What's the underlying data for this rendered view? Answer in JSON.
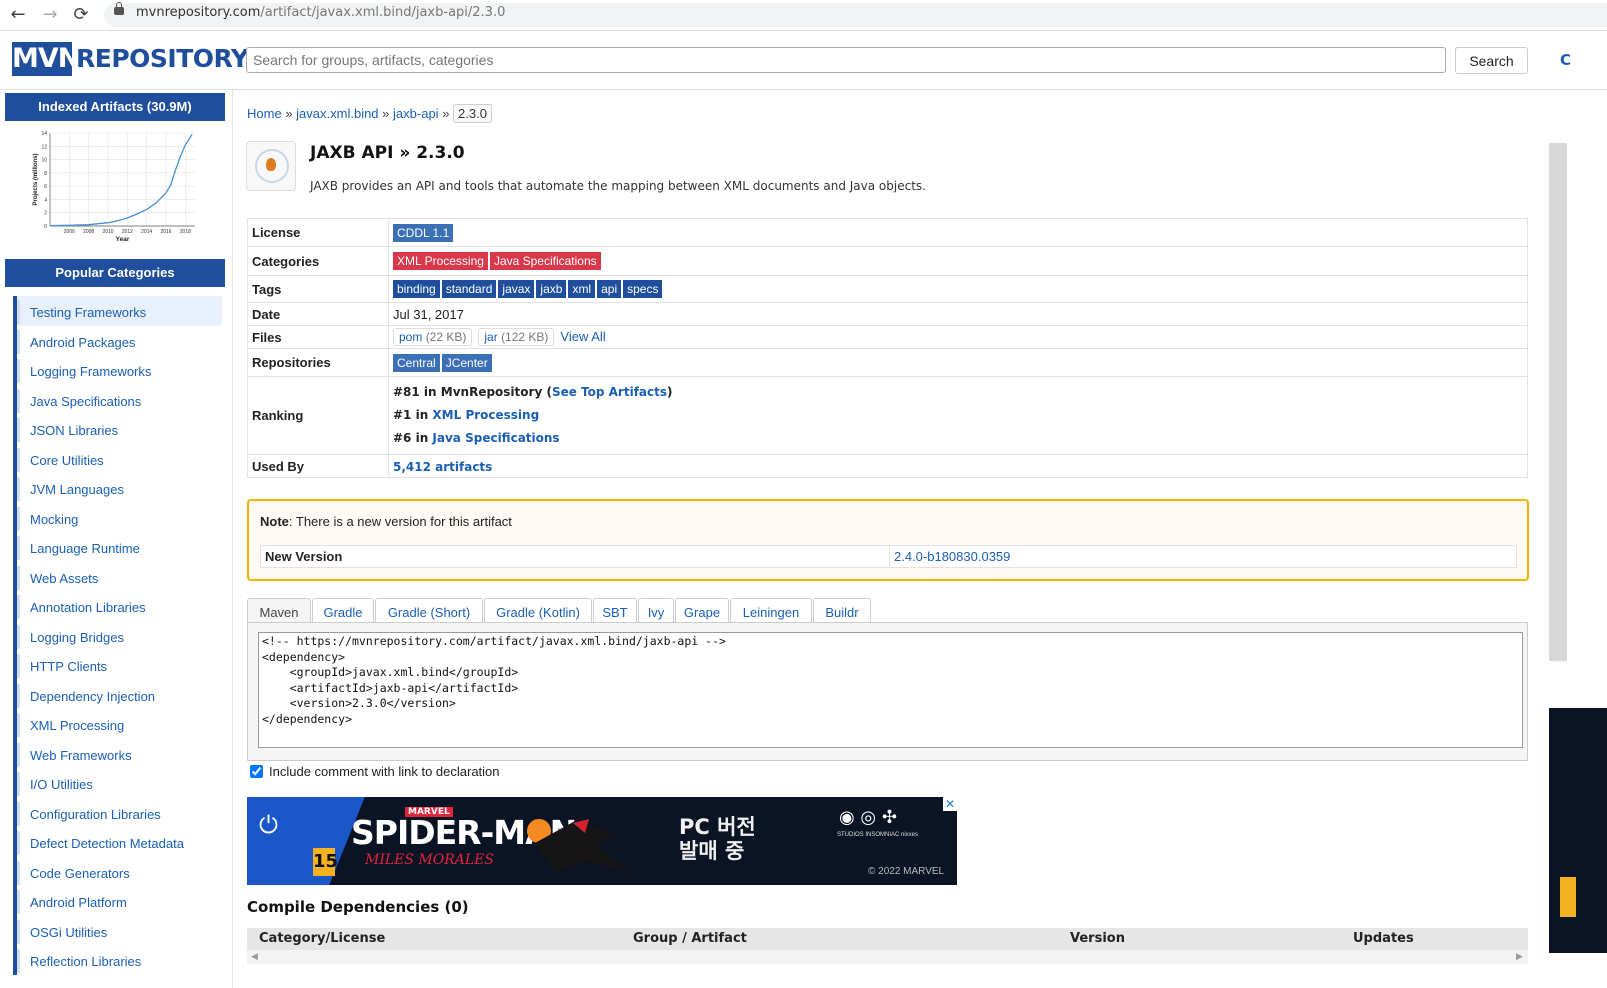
{
  "browser": {
    "url_host": "mvnrepository.com",
    "url_path": "/artifact/javax.xml.bind/jaxb-api/2.3.0"
  },
  "header": {
    "logo_left": "MVN",
    "logo_right": "REPOSITORY",
    "search_placeholder": "Search for groups, artifacts, categories",
    "search_button": "Search",
    "edge_text": "C"
  },
  "sidebar": {
    "indexed_title": "Indexed Artifacts (30.9M)",
    "popular_title": "Popular Categories",
    "categories": [
      "Testing Frameworks",
      "Android Packages",
      "Logging Frameworks",
      "Java Specifications",
      "JSON Libraries",
      "Core Utilities",
      "JVM Languages",
      "Mocking",
      "Language Runtime",
      "Web Assets",
      "Annotation Libraries",
      "Logging Bridges",
      "HTTP Clients",
      "Dependency Injection",
      "XML Processing",
      "Web Frameworks",
      "I/O Utilities",
      "Configuration Libraries",
      "Defect Detection Metadata",
      "Code Generators",
      "Android Platform",
      "OSGi Utilities",
      "Reflection Libraries"
    ]
  },
  "chart_data": {
    "type": "line",
    "title": "",
    "xlabel": "Year",
    "ylabel": "Projects (millions)",
    "x_ticks": [
      "2006",
      "2008",
      "2010",
      "2012",
      "2014",
      "2016",
      "2018"
    ],
    "y_ticks": [
      "0",
      "2",
      "4",
      "6",
      "8",
      "10",
      "12",
      "14"
    ],
    "xlim": [
      2004,
      2019
    ],
    "ylim": [
      0,
      14
    ],
    "series": [
      {
        "x": [
          2004,
          2006,
          2008,
          2009,
          2010,
          2011,
          2012,
          2013,
          2014,
          2015,
          2016,
          2016.5,
          2017,
          2017.5,
          2018,
          2018.7
        ],
        "y": [
          0.05,
          0.1,
          0.2,
          0.35,
          0.5,
          0.8,
          1.2,
          1.8,
          2.5,
          3.5,
          5.0,
          6.2,
          8.5,
          10.5,
          12.2,
          13.8
        ]
      }
    ]
  },
  "breadcrumb": {
    "home": "Home",
    "sep": "»",
    "group": "javax.xml.bind",
    "artifact": "jaxb-api",
    "version": "2.3.0"
  },
  "artifact": {
    "title": "JAXB API » 2.3.0",
    "description": "JAXB provides an API and tools that automate the mapping between XML documents and Java objects."
  },
  "details": {
    "license_label": "License",
    "license": "CDDL 1.1",
    "categories_label": "Categories",
    "categories": [
      "XML Processing",
      "Java Specifications"
    ],
    "tags_label": "Tags",
    "tags": [
      "binding",
      "standard",
      "javax",
      "jaxb",
      "xml",
      "api",
      "specs"
    ],
    "date_label": "Date",
    "date": "Jul 31, 2017",
    "files_label": "Files",
    "files": [
      {
        "name": "pom",
        "size": "(22 KB)"
      },
      {
        "name": "jar",
        "size": "(122 KB)"
      }
    ],
    "view_all": "View All",
    "repos_label": "Repositories",
    "repos": [
      "Central",
      "JCenter"
    ],
    "ranking_label": "Ranking",
    "rank1_prefix": "#81 in MvnRepository (",
    "rank1_link": "See Top Artifacts",
    "rank1_suffix": ")",
    "rank2_prefix": "#1 in ",
    "rank2_link": "XML Processing",
    "rank3_prefix": "#6 in ",
    "rank3_link": "Java Specifications",
    "usedby_label": "Used By",
    "usedby": "5,412 artifacts"
  },
  "note": {
    "bold": "Note",
    "text": ": There is a new version for this artifact",
    "new_version_label": "New Version",
    "new_version": "2.4.0-b180830.0359"
  },
  "tabs": [
    "Maven",
    "Gradle",
    "Gradle (Short)",
    "Gradle (Kotlin)",
    "SBT",
    "Ivy",
    "Grape",
    "Leiningen",
    "Buildr"
  ],
  "code": "<!-- https://mvnrepository.com/artifact/javax.xml.bind/jaxb-api -->\n<dependency>\n    <groupId>javax.xml.bind</groupId>\n    <artifactId>jaxb-api</artifactId>\n    <version>2.3.0</version>\n</dependency>",
  "include_comment": "Include comment with link to declaration",
  "ad": {
    "brand": "MARVEL",
    "title": "SPIDER-MAN",
    "subtitle": "MILES MORALES",
    "rating": "15",
    "headline_1": "PC 버전",
    "headline_2": "발매 중",
    "logos": "STUDIOS  INSOMNIAC  nixxes",
    "copyright": "© 2022 MARVEL"
  },
  "dependencies": {
    "title": "Compile Dependencies (0)",
    "columns": [
      "Category/License",
      "Group / Artifact",
      "Version",
      "Updates"
    ]
  }
}
